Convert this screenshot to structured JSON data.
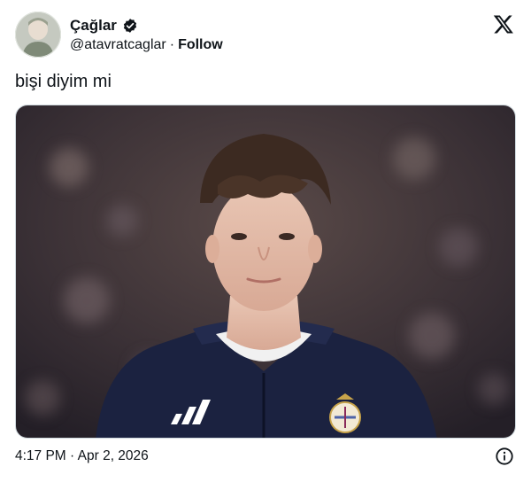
{
  "author": {
    "display_name": "Çağlar",
    "handle": "@atavratcaglar",
    "separator": "·",
    "follow_label": "Follow",
    "verified": true
  },
  "tweet": {
    "text": "bişi diyim mi",
    "timestamp": "4:17 PM · Apr 2, 2026"
  },
  "icons": {
    "verified": "verified-badge-icon",
    "logo": "x-logo-icon",
    "info": "info-icon"
  },
  "colors": {
    "text": "#0f1419",
    "border": "#cfd9de",
    "jacket": "#1b2240"
  }
}
